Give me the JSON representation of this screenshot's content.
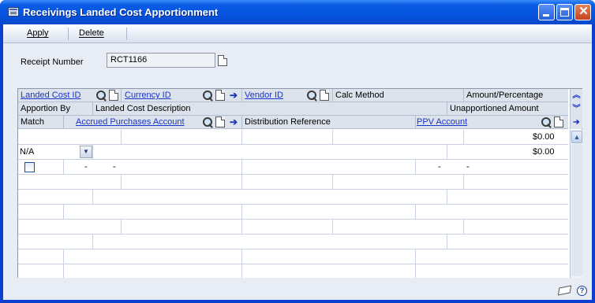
{
  "window": {
    "title": "Receivings Landed Cost Apportionment"
  },
  "toolbar": {
    "apply_label": "Apply",
    "delete_label": "Delete"
  },
  "receipt": {
    "label": "Receipt Number",
    "value": "RCT1166"
  },
  "grid": {
    "header_row1": {
      "landed_cost_id": "Landed Cost ID",
      "currency_id": "Currency ID",
      "vendor_id": "Vendor ID",
      "calc_method": "Calc Method",
      "amount_percentage": "Amount/Percentage"
    },
    "header_row2": {
      "apportion_by": "Apportion By",
      "landed_cost_description": "Landed Cost Description",
      "unapportioned_amount": "Unapportioned Amount"
    },
    "header_row3": {
      "match": "Match",
      "accrued_purchases_account": "Accrued Purchases Account",
      "distribution_reference": "Distribution Reference",
      "ppv_account": "PPV Account"
    },
    "rows": {
      "amount": "$0.00",
      "apportion_by": "N/A",
      "unapportioned_amount": "$0.00",
      "dash": "-"
    }
  },
  "icons": {
    "app": "window-icon",
    "lookup": "magnifier-icon",
    "new": "note-icon",
    "expand": "arrow-right-icon",
    "help": "help-icon"
  },
  "help": {
    "glyph": "?"
  }
}
